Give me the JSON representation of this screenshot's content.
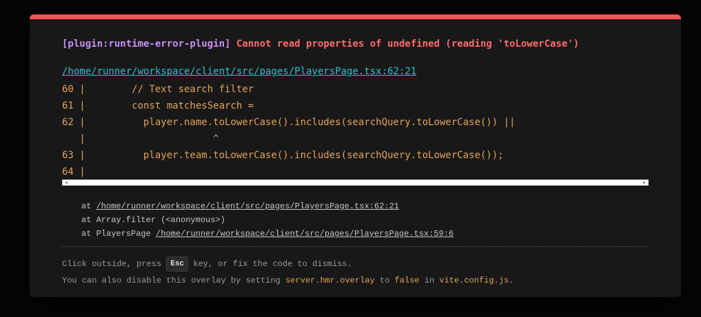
{
  "error": {
    "plugin": "[plugin:runtime-error-plugin]",
    "message": "Cannot read properties of undefined (reading 'toLowerCase')"
  },
  "file": {
    "path": "/home/runner/workspace/client/src/pages/PlayersPage.tsx:62:21"
  },
  "code_frame": {
    "lines": [
      "60 |        // Text search filter",
      "61 |        const matchesSearch =",
      "62 |          player.name.toLowerCase().includes(searchQuery.toLowerCase()) ||",
      "   |                      ^",
      "63 |          player.team.toLowerCase().includes(searchQuery.toLowerCase());",
      "64 |"
    ]
  },
  "stack": {
    "line1_prefix": "at ",
    "line1_link": "/home/runner/workspace/client/src/pages/PlayersPage.tsx:62:21",
    "line2": "at Array.filter (<anonymous>)",
    "line3_prefix": "at PlayersPage ",
    "line3_link": "/home/runner/workspace/client/src/pages/PlayersPage.tsx:59:6"
  },
  "tip": {
    "line1_before": "Click outside, press ",
    "key": "Esc",
    "line1_after": " key, or fix the code to dismiss.",
    "line2_before": "You can also disable this overlay by setting ",
    "config_key": "server.hmr.overlay",
    "line2_mid": " to ",
    "value": "false",
    "line2_in": " in ",
    "config_file": "vite.config.js",
    "line2_end": "."
  },
  "colors": {
    "accent_bar": "#ff5555",
    "plugin": "#cb8ef7",
    "error": "#ff6b6b",
    "file_link": "#2dc1d6",
    "code": "#e5a35a"
  }
}
